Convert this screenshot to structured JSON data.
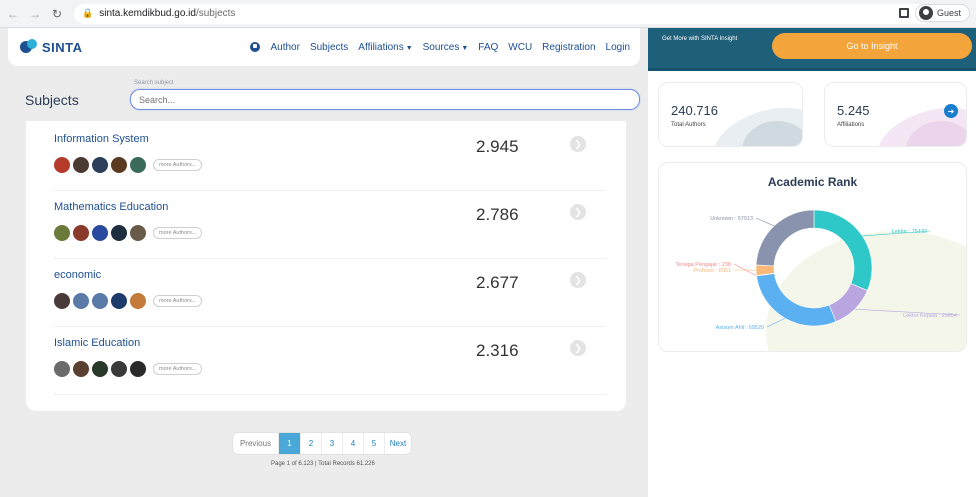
{
  "browser": {
    "url_host": "sinta.kemdikbud.go.id",
    "url_path": "/subjects",
    "profile_label": "Guest"
  },
  "header": {
    "logo_text": "SINTA",
    "menu": [
      {
        "label": "Author"
      },
      {
        "label": "Subjects"
      },
      {
        "label": "Affiliations",
        "dropdown": true
      },
      {
        "label": "Sources",
        "dropdown": true
      },
      {
        "label": "FAQ"
      },
      {
        "label": "WCU"
      },
      {
        "label": "Registration"
      },
      {
        "label": "Login"
      }
    ]
  },
  "page": {
    "title": "Subjects",
    "search_label": "Search subject",
    "search_placeholder": "Search..."
  },
  "subjects": [
    {
      "name": "Information System",
      "count": "2.945",
      "more": "more Authors...",
      "avatar_colors": [
        "#b53a2a",
        "#4a3a32",
        "#2c3f5a",
        "#5a3b22",
        "#3a6a5a"
      ]
    },
    {
      "name": "Mathematics Education",
      "count": "2.786",
      "more": "more Authors...",
      "avatar_colors": [
        "#6a7a3a",
        "#8a3a2a",
        "#2a4aa0",
        "#1e2e3e",
        "#6a5a4a"
      ]
    },
    {
      "name": "economic",
      "count": "2.677",
      "more": "more Authors...",
      "avatar_colors": [
        "#4a3a3a",
        "#5a7aa8",
        "#5a7aa8",
        "#1c3a6a",
        "#c47a3a"
      ]
    },
    {
      "name": "Islamic Education",
      "count": "2.316",
      "more": "more Authors...",
      "avatar_colors": [
        "#6a6a6a",
        "#5a4030",
        "#2a3a2a",
        "#3a3a3a",
        "#2a2a2a"
      ]
    }
  ],
  "pagination": {
    "previous": "Previous",
    "pages": [
      "1",
      "2",
      "3",
      "4",
      "5"
    ],
    "next": "Next",
    "active": "1",
    "info": "Page 1 of 6.123 | Total Records 61.226"
  },
  "sidebar": {
    "insight_text": "Get More with SINTA Insight",
    "insight_button": "Go to Insight",
    "stats": [
      {
        "value": "240.716",
        "label": "Total Authors"
      },
      {
        "value": "5.245",
        "label": "Affiliations"
      }
    ]
  },
  "colors": {
    "brand": "#1d4f91",
    "insight_bar": "#1e5f7a",
    "insight_button": "#f3a43b",
    "active_page": "#4aa8d8"
  },
  "chart_data": {
    "type": "pie",
    "title": "Academic Rank",
    "donut": true,
    "categories": [
      "Lektor",
      "Lektor Kepala",
      "Asisten Ahli",
      "Tenaga Pengajar",
      "Profesor",
      "Unknown"
    ],
    "values": [
      75132,
      29854,
      69520,
      238,
      6951,
      57913
    ],
    "labels": [
      "Lektor : 75132",
      "Lektor Kepala : 29854",
      "Asisten Ahli : 69520",
      "Tenaga Pengajar : 238",
      "Profesor : 6951",
      "Unknown : 57913"
    ],
    "colors": [
      "#2ec8c8",
      "#b9a6e0",
      "#5ab0f0",
      "#f58a8a",
      "#f8b878",
      "#8a93ad"
    ]
  }
}
